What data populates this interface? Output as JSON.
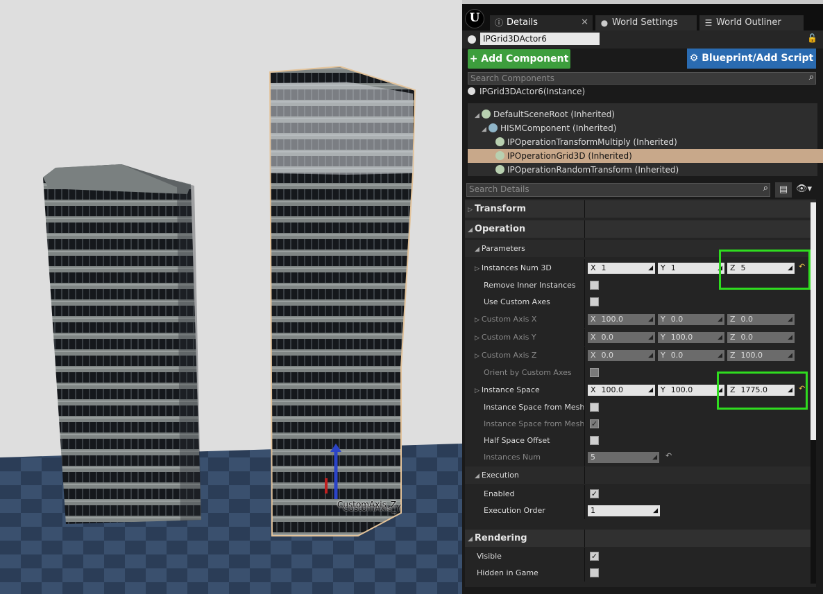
{
  "viewport": {
    "gizmo_label": "CustomAxis_Z",
    "gizmo_label_shadow": "CustomAxis_Y"
  },
  "tabs": [
    {
      "label": "Details",
      "icon": "info-icon",
      "active": true
    },
    {
      "label": "World Settings",
      "icon": "globe-icon",
      "active": false
    },
    {
      "label": "World Outliner",
      "icon": "outliner-icon",
      "active": false
    }
  ],
  "actor": {
    "name": "IPGrid3DActor6"
  },
  "toolbar": {
    "add_component_label": "+ Add Component ▾",
    "blueprint_label": "Blueprint/Add Script"
  },
  "components": {
    "search_placeholder": "Search Components",
    "instance_label": "IPGrid3DActor6(Instance)",
    "tree": [
      {
        "label": "DefaultSceneRoot (Inherited)",
        "level": 0,
        "selected": false
      },
      {
        "label": "HISMComponent (Inherited)",
        "level": 1,
        "selected": false
      },
      {
        "label": "IPOperationTransformMultiply (Inherited)",
        "level": 2,
        "selected": false
      },
      {
        "label": "IPOperationGrid3D (Inherited)",
        "level": 2,
        "selected": true
      },
      {
        "label": "IPOperationRandomTransform (Inherited)",
        "level": 2,
        "selected": false
      }
    ]
  },
  "details": {
    "search_placeholder": "Search Details",
    "cat_transform": "Transform",
    "cat_operation": "Operation",
    "sub_parameters": "Parameters",
    "instances_num_3d": {
      "label": "Instances Num 3D",
      "x": "1",
      "y": "1",
      "z": "5"
    },
    "remove_inner": {
      "label": "Remove Inner Instances",
      "checked": false
    },
    "use_custom_axes": {
      "label": "Use Custom Axes",
      "checked": false
    },
    "custom_axis_x": {
      "label": "Custom Axis X",
      "x": "100.0",
      "y": "0.0",
      "z": "0.0"
    },
    "custom_axis_y": {
      "label": "Custom Axis Y",
      "x": "0.0",
      "y": "100.0",
      "z": "0.0"
    },
    "custom_axis_z": {
      "label": "Custom Axis Z",
      "x": "0.0",
      "y": "0.0",
      "z": "100.0"
    },
    "orient_custom": {
      "label": "Orient by Custom Axes",
      "checked": false
    },
    "instance_space": {
      "label": "Instance Space",
      "x": "100.0",
      "y": "100.0",
      "z": "1775.0"
    },
    "space_from_mesh_1": {
      "label": "Instance Space from Mesh B",
      "checked": false
    },
    "space_from_mesh_2": {
      "label": "Instance Space from Mesh B",
      "checked": true
    },
    "half_space_offset": {
      "label": "Half Space Offset",
      "checked": false
    },
    "instances_num": {
      "label": "Instances Num",
      "value": "5"
    },
    "sub_execution": "Execution",
    "enabled": {
      "label": "Enabled",
      "checked": true
    },
    "execution_order": {
      "label": "Execution Order",
      "value": "1"
    },
    "cat_rendering": "Rendering",
    "visible": {
      "label": "Visible",
      "checked": true
    },
    "hidden_in_game": {
      "label": "Hidden in Game",
      "checked": false
    }
  },
  "axis_letters": {
    "x": "X",
    "y": "Y",
    "z": "Z"
  },
  "highlight_color": "#2fdc1f",
  "selection_color": "#c8a88a"
}
